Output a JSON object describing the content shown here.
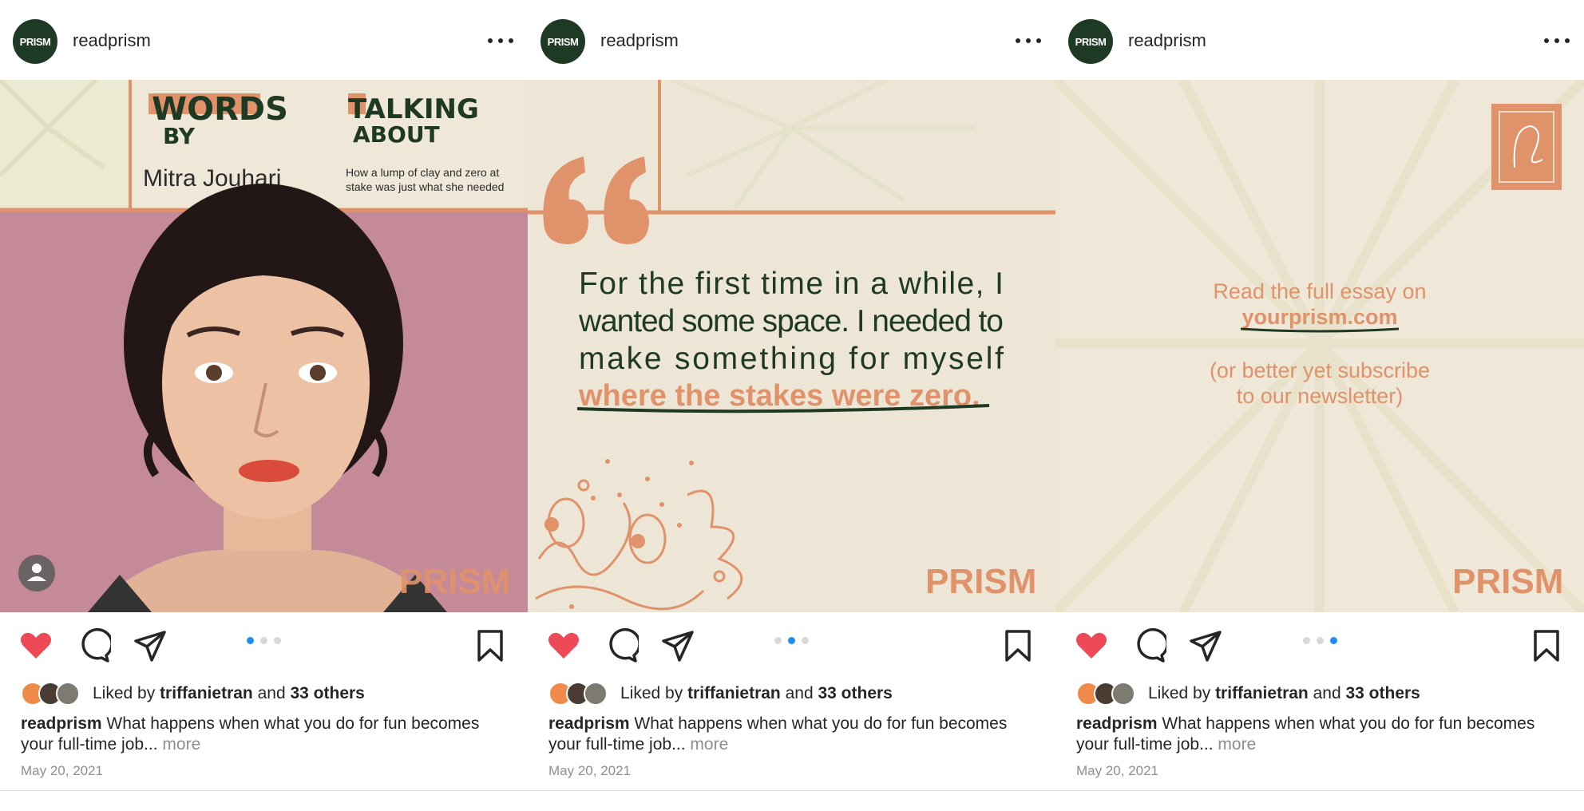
{
  "posts": [
    {
      "account": {
        "username": "readprism",
        "avatar_text": "PRISM"
      },
      "slide": {
        "type": "intro",
        "words_by_label_1": "WORDS",
        "words_by_label_2": "BY",
        "author": "Mitra Jouhari",
        "talking_about_label_1": "TALKING",
        "talking_about_label_2": "ABOUT",
        "topic_line_1": "How a lump of clay and zero at",
        "topic_line_2": "stake was just what she needed",
        "watermark": "PRISM"
      },
      "carousel": {
        "count": 3,
        "active": 0
      },
      "likes": {
        "prefix": "Liked by",
        "user": "triffanietran",
        "joiner": "and",
        "others": "33 others"
      },
      "caption": {
        "username": "readprism",
        "text": "What happens when what you do for fun becomes your full-time job...",
        "more": "more"
      },
      "date": "May 20, 2021"
    },
    {
      "account": {
        "username": "readprism",
        "avatar_text": "PRISM"
      },
      "slide": {
        "type": "quote",
        "quote_line_1": "For the first time in a while, I",
        "quote_line_2": "wanted some space. I needed to",
        "quote_line_3": "make something for myself",
        "quote_highlight": "where the stakes were zero.",
        "watermark": "PRISM"
      },
      "carousel": {
        "count": 3,
        "active": 1
      },
      "likes": {
        "prefix": "Liked by",
        "user": "triffanietran",
        "joiner": "and",
        "others": "33 others"
      },
      "caption": {
        "username": "readprism",
        "text": "What happens when what you do for fun becomes your full-time job...",
        "more": "more"
      },
      "date": "May 20, 2021"
    },
    {
      "account": {
        "username": "readprism",
        "avatar_text": "PRISM"
      },
      "slide": {
        "type": "cta",
        "cta_line_1": "Read the full essay on",
        "cta_link": "yourprism.com",
        "cta_line_3": "(or better yet subscribe",
        "cta_line_4": "to our newsletter)",
        "watermark": "PRISM"
      },
      "carousel": {
        "count": 3,
        "active": 2
      },
      "likes": {
        "prefix": "Liked by",
        "user": "triffanietran",
        "joiner": "and",
        "others": "33 others"
      },
      "caption": {
        "username": "readprism",
        "text": "What happens when what you do for fun becomes your full-time job...",
        "more": "more"
      },
      "date": "May 20, 2021"
    }
  ],
  "colors": {
    "brand_green": "#1f3a24",
    "accent_orange": "#e0926a",
    "cream": "#ede6d7",
    "like_red": "#ed4956",
    "dot_active": "#1f8ef1",
    "photo_pink": "#c48a98"
  },
  "icons": [
    "more-icon",
    "heart-icon",
    "comment-icon",
    "share-icon",
    "bookmark-icon",
    "user-tag-icon",
    "quote-mark-icon",
    "stamp-icon"
  ]
}
